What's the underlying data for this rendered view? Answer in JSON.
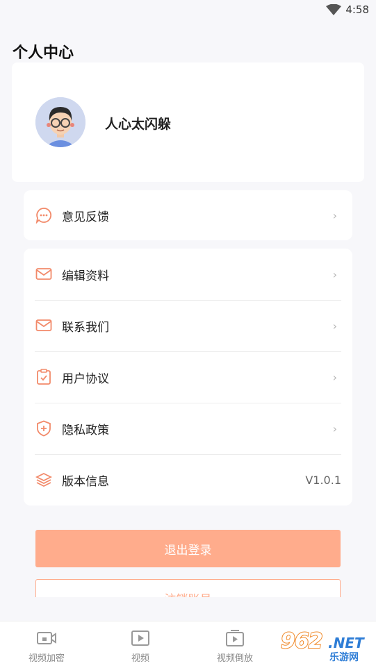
{
  "status_bar": {
    "time": "4:58"
  },
  "page_title": "个人中心",
  "profile": {
    "username": "人心太闪躲"
  },
  "feedback": {
    "label": "意见反馈"
  },
  "menu": {
    "items": [
      {
        "label": "编辑资料",
        "icon": "mail-icon"
      },
      {
        "label": "联系我们",
        "icon": "mail-icon"
      },
      {
        "label": "用户协议",
        "icon": "clipboard-icon"
      },
      {
        "label": "隐私政策",
        "icon": "shield-icon"
      },
      {
        "label": "版本信息",
        "icon": "layers-icon",
        "value": "V1.0.1"
      }
    ]
  },
  "buttons": {
    "logout": "退出登录",
    "cancel_account": "注销账号"
  },
  "bottom_nav": [
    {
      "label": "视频加密",
      "icon": "video-lock-icon"
    },
    {
      "label": "视频",
      "icon": "play-icon"
    },
    {
      "label": "视频倒放",
      "icon": "video-reverse-icon"
    }
  ],
  "watermark": {
    "number": "962",
    "suffix": ".NET",
    "sub": "乐游网"
  },
  "colors": {
    "accent": "#ffac8c",
    "icon": "#f28a6a",
    "background": "#f7f7fa"
  }
}
